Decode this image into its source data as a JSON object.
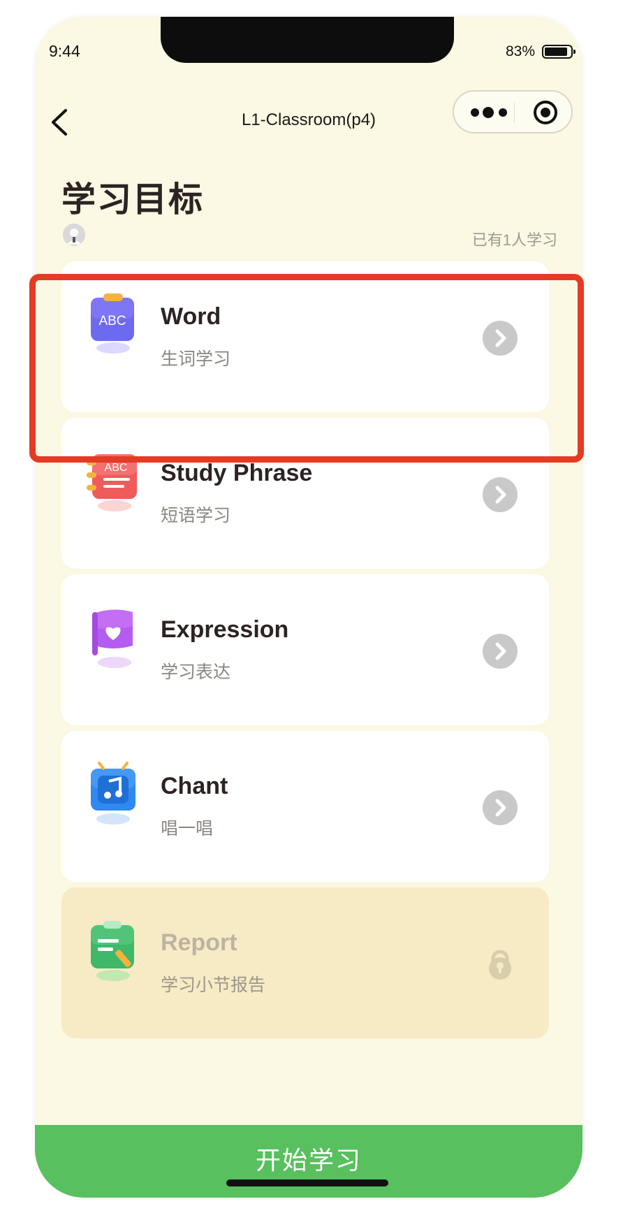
{
  "status_bar": {
    "time": "9:44",
    "battery": "83%",
    "battery_level": 0.83
  },
  "nav": {
    "title": "L1-Classroom(p4)"
  },
  "header": {
    "title": "学习目标",
    "learner_count": "已有1人学习"
  },
  "cards": [
    {
      "name": "Word",
      "subtitle": "生词学习",
      "icon": "abc-clipboard-icon",
      "locked": false,
      "highlighted": true
    },
    {
      "name": "Study  Phrase",
      "subtitle": "短语学习",
      "icon": "abc-notebook-icon",
      "locked": false,
      "highlighted": false
    },
    {
      "name": "Expression",
      "subtitle": "学习表达",
      "icon": "heart-flag-icon",
      "locked": false,
      "highlighted": false
    },
    {
      "name": "Chant",
      "subtitle": "唱一唱",
      "icon": "music-tv-icon",
      "locked": false,
      "highlighted": false
    },
    {
      "name": "Report",
      "subtitle": "学习小节报告",
      "icon": "report-clipboard-icon",
      "locked": true,
      "highlighted": false
    }
  ],
  "footer": {
    "start_button": "开始学习"
  },
  "icon_labels": {
    "abc": "ABC"
  },
  "colors": {
    "background": "#fbf8e3",
    "card": "#ffffff",
    "locked_card": "#f6ebc5",
    "primary_button": "#58c05e",
    "highlight_border": "#e43b25",
    "arrow_circle": "#c9c9c9"
  }
}
